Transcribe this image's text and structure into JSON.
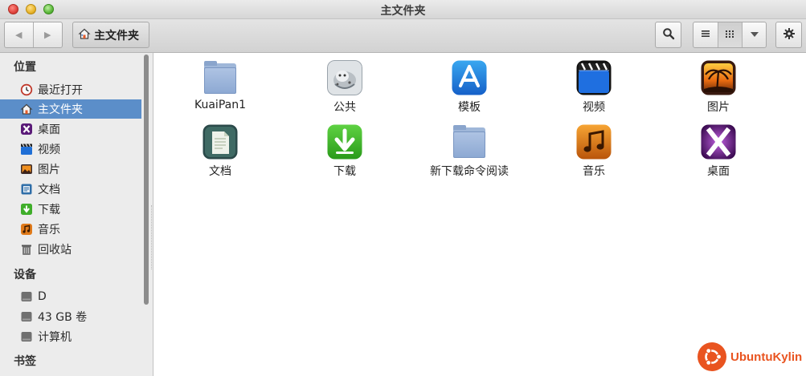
{
  "window": {
    "title": "主文件夹"
  },
  "toolbar": {
    "location_label": "主文件夹",
    "back_label": "◀",
    "forward_label": "▶"
  },
  "sidebar": {
    "sections": [
      {
        "heading": "位置",
        "items": [
          {
            "label": "最近打开",
            "icon": "recent-icon"
          },
          {
            "label": "主文件夹",
            "icon": "home-icon",
            "selected": true
          },
          {
            "label": "桌面",
            "icon": "desktop-icon"
          },
          {
            "label": "视频",
            "icon": "videos-icon"
          },
          {
            "label": "图片",
            "icon": "pictures-icon"
          },
          {
            "label": "文档",
            "icon": "documents-icon"
          },
          {
            "label": "下载",
            "icon": "downloads-icon"
          },
          {
            "label": "音乐",
            "icon": "music-icon"
          },
          {
            "label": "回收站",
            "icon": "trash-icon"
          }
        ]
      },
      {
        "heading": "设备",
        "items": [
          {
            "label": "D",
            "icon": "drive-icon"
          },
          {
            "label": "43 GB 卷",
            "icon": "drive-icon"
          },
          {
            "label": "计算机",
            "icon": "drive-icon"
          }
        ]
      },
      {
        "heading": "书签",
        "items": []
      }
    ]
  },
  "files": [
    {
      "label": "KuaiPan1",
      "icon": "folder-icon"
    },
    {
      "label": "公共",
      "icon": "public-icon"
    },
    {
      "label": "模板",
      "icon": "templates-icon"
    },
    {
      "label": "视频",
      "icon": "videos-icon"
    },
    {
      "label": "图片",
      "icon": "pictures-icon"
    },
    {
      "label": "文档",
      "icon": "documents-icon"
    },
    {
      "label": "下载",
      "icon": "downloads-icon"
    },
    {
      "label": "新下载命令阅读",
      "icon": "folder-icon"
    },
    {
      "label": "音乐",
      "icon": "music-icon"
    },
    {
      "label": "桌面",
      "icon": "desktop-icon"
    }
  ],
  "branding": {
    "logo_text": "UbuntuKylin"
  },
  "colors": {
    "accent": "#5b8ec9",
    "brand": "#e95420"
  }
}
